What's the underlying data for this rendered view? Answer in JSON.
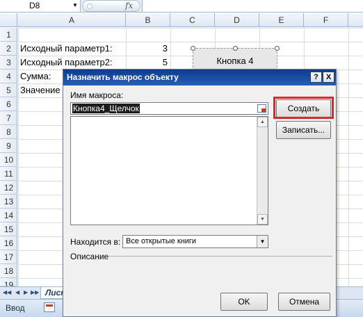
{
  "formula_bar": {
    "name_box": "D8",
    "fx": "fx"
  },
  "columns": [
    "A",
    "B",
    "C",
    "D",
    "E",
    "F"
  ],
  "rows": [
    "1",
    "2",
    "3",
    "4",
    "5",
    "6",
    "7",
    "8",
    "9",
    "10",
    "11",
    "12",
    "13",
    "14",
    "15",
    "16",
    "17",
    "18",
    "19"
  ],
  "cells": {
    "a2": "Исходный параметр1:",
    "a3": "Исходный параметр2:",
    "a4": "Сумма:",
    "a5": "Значение",
    "b2": "3",
    "b3": "5"
  },
  "shape_button": {
    "label": "Кнопка 4"
  },
  "sheet_tab": {
    "label": "Лист"
  },
  "status_bar": {
    "mode": "Ввод"
  },
  "dialog": {
    "title": "Назначить макрос объекту",
    "help_label": "?",
    "close_label": "X",
    "macro_name_label": "Имя макроса:",
    "macro_name_value": "Кнопка4_Щелчок",
    "location_label": "Находится в:",
    "location_value": "Все открытые книги",
    "description_label": "Описание",
    "buttons": {
      "create": "Создать",
      "record": "Записать...",
      "ok": "OK",
      "cancel": "Отмена"
    }
  },
  "colors": {
    "titlebar": "#1a4fa0",
    "highlight": "#d42a2a"
  }
}
